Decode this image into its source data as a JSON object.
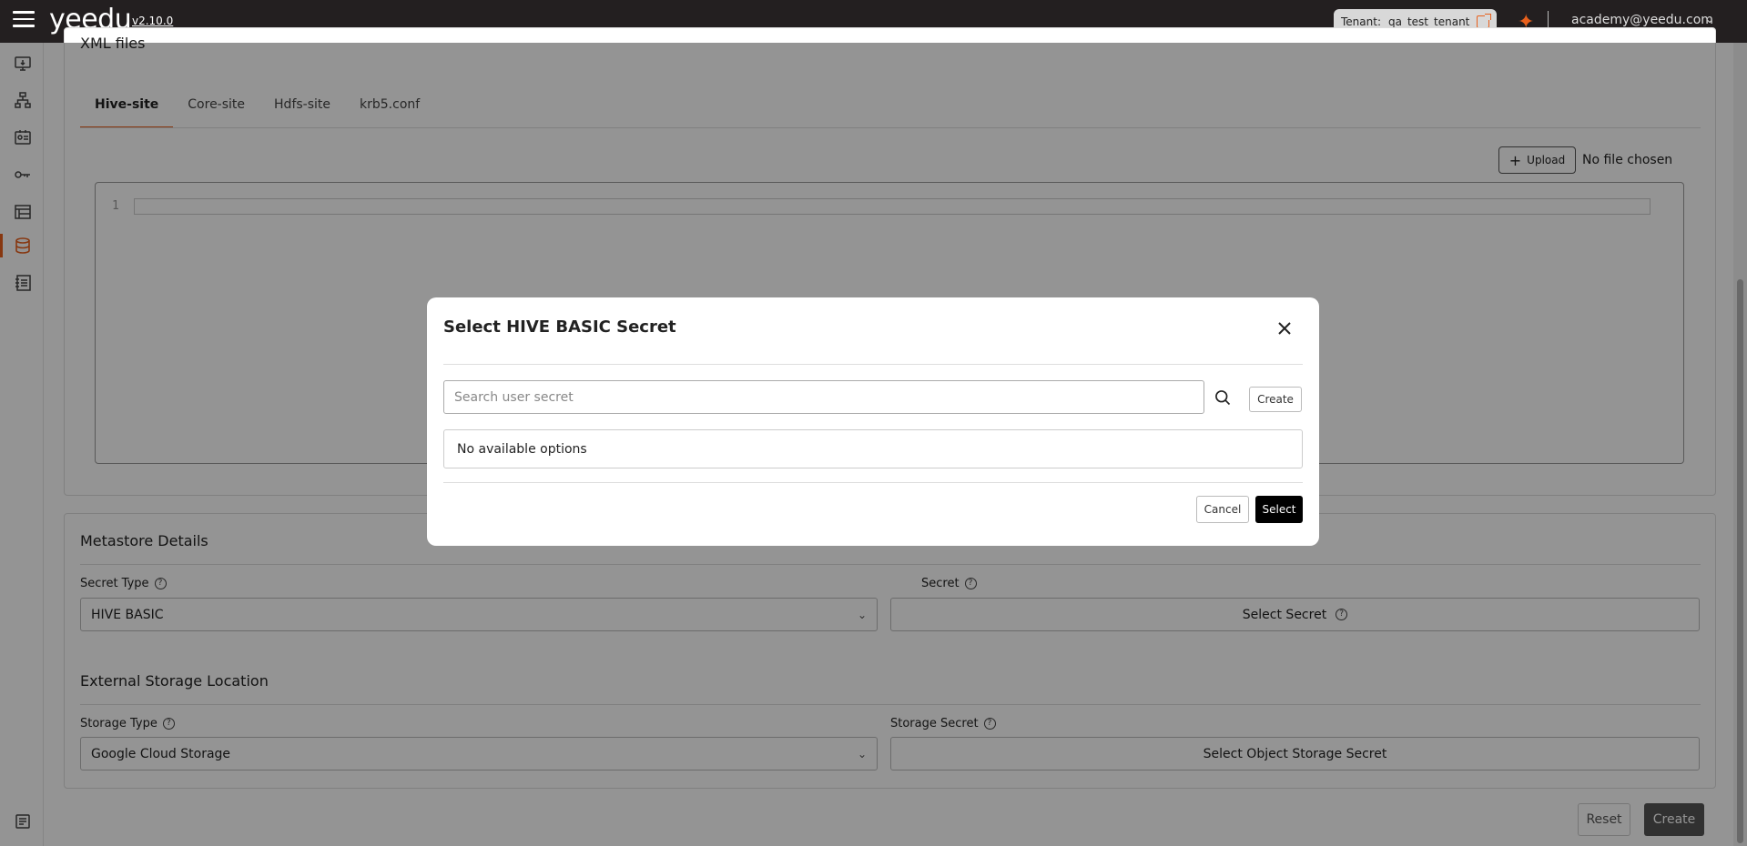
{
  "header": {
    "logo": "yeedu",
    "version": "v2.10.0",
    "tenant_label": "Tenant:",
    "tenant_name": "qa_test_tenant",
    "user_email": "academy@yeedu.com"
  },
  "xml_files": {
    "title": "XML files",
    "tabs": [
      {
        "label": "Hive-site",
        "active": true
      },
      {
        "label": "Core-site"
      },
      {
        "label": "Hdfs-site"
      },
      {
        "label": "krb5.conf"
      }
    ],
    "upload_label": "Upload",
    "file_status": "No file chosen",
    "line_number": "1"
  },
  "metastore": {
    "title": "Metastore Details",
    "secret_type_label": "Secret Type",
    "secret_type_value": "HIVE BASIC",
    "secret_label": "Secret",
    "secret_button": "Select Secret"
  },
  "external_storage": {
    "title": "External Storage Location",
    "storage_type_label": "Storage Type",
    "storage_type_value": "Google Cloud Storage",
    "storage_secret_label": "Storage Secret",
    "storage_secret_button": "Select Object Storage Secret"
  },
  "footer": {
    "reset_label": "Reset",
    "create_label": "Create"
  },
  "modal": {
    "title": "Select HIVE BASIC Secret",
    "search_placeholder": "Search user secret",
    "create_label": "Create",
    "empty_message": "No available options",
    "cancel_label": "Cancel",
    "select_label": "Select"
  },
  "colors": {
    "topbar": "#231f20",
    "accent": "#e8601c",
    "select_button": "#000000"
  },
  "icons": {
    "sidebar": [
      "monitor-icon",
      "hierarchy-icon",
      "id-card-icon",
      "key-icon",
      "workspace-icon",
      "database-icon",
      "notebook-icon",
      "docs-icon"
    ]
  }
}
